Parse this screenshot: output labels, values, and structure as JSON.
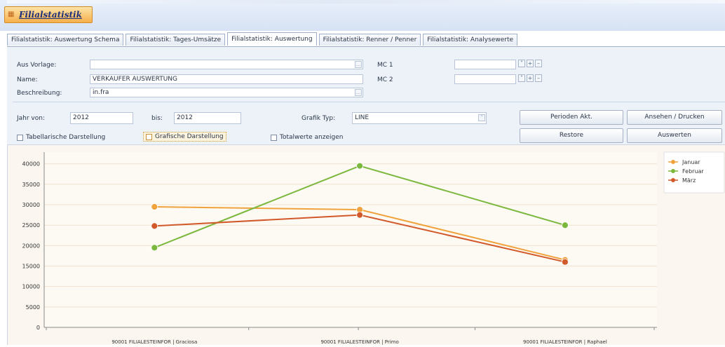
{
  "window": {
    "title": "Filialstatistik",
    "icon": "app-icon"
  },
  "tabs": [
    {
      "label": "Filialstatistik: Auswertung Schema",
      "active": false
    },
    {
      "label": "Filialstatistik: Tages-Umsätze",
      "active": false
    },
    {
      "label": "Filialstatistik: Auswertung",
      "active": true
    },
    {
      "label": "Filialstatistik: Renner / Penner",
      "active": false
    },
    {
      "label": "Filialstatistik: Analysewerte",
      "active": false
    }
  ],
  "form": {
    "aus_vorlage_label": "Aus Vorlage:",
    "aus_vorlage_value": "",
    "name_label": "Name:",
    "name_value": "VERKAUFER AUSWERTUNG",
    "beschreibung_label": "Beschreibung:",
    "beschreibung_value": "in.fra",
    "mc1_label": "MC 1",
    "mc1_value": "",
    "mc2_label": "MC 2",
    "mc2_value": "",
    "jahr_von_label": "Jahr von:",
    "jahr_von_value": "2012",
    "bis_label": "bis:",
    "bis_value": "2012",
    "grafik_typ_label": "Grafik Typ:",
    "grafik_typ_value": "LINE"
  },
  "checkboxes": {
    "tabellarische": {
      "label": "Tabellarische Darstellung",
      "checked": false
    },
    "grafische": {
      "label": "Grafische Darstellung",
      "checked": false
    },
    "totalwerte": {
      "label": "Totalwerte anzeigen",
      "checked": false
    }
  },
  "buttons": {
    "perioden_akt": "Perioden Akt.",
    "ansehen_drucken": "Ansehen / Drucken",
    "restore": "Restore",
    "auswerten": "Auswerten"
  },
  "chart_data": {
    "type": "line",
    "categories": [
      "90001 FILIALESTEINFOR | Graciosa",
      "90001 FILIALESTEINFOR | Primo",
      "90001 FILIALESTEINFOR | Raphael"
    ],
    "series": [
      {
        "name": "Januar",
        "color": "#f0a33c",
        "values": [
          29500,
          28800,
          16500
        ]
      },
      {
        "name": "Februar",
        "color": "#7cb83e",
        "values": [
          19500,
          39500,
          25000
        ]
      },
      {
        "name": "März",
        "color": "#d2592a",
        "values": [
          24800,
          27500,
          16000
        ]
      }
    ],
    "yticks": [
      "0",
      "5000",
      "10000",
      "15000",
      "20000",
      "25000",
      "30000",
      "35000",
      "40000"
    ],
    "ylim": [
      0,
      40000
    ],
    "legend_position": "top-right",
    "grid": true
  }
}
